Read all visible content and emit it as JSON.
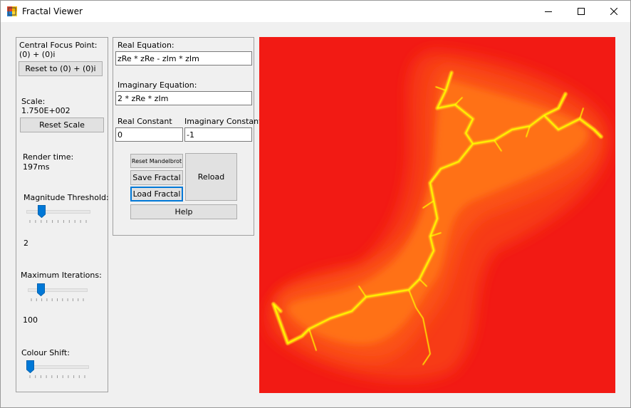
{
  "window": {
    "title": "Fractal Viewer"
  },
  "left_panel": {
    "focus_label": "Central Focus Point:",
    "focus_value": "(0) + (0)i",
    "reset_focus_label": "Reset to (0) + (0)i",
    "scale_label": "Scale:",
    "scale_value": "1.750E+002",
    "reset_scale_label": "Reset Scale",
    "render_label": "Render time:",
    "render_value": "197ms",
    "magnitude_label": "Magnitude Threshold:",
    "magnitude_value": "2",
    "iterations_label": "Maximum Iterations:",
    "iterations_value": "100",
    "colour_label": "Colour Shift:"
  },
  "sliders": {
    "magnitude_fraction": 0.2,
    "iterations_fraction": 0.18,
    "colour_fraction": 0.0
  },
  "equations": {
    "real_label": "Real Equation:",
    "real_value": "zRe * zRe - zIm * zIm",
    "imag_label": "Imaginary Equation:",
    "imag_value": "2 * zRe * zIm",
    "real_const_label": "Real Constant",
    "real_const_value": "0",
    "imag_const_label": "Imaginary Constant",
    "imag_const_value": "-1"
  },
  "buttons": {
    "reset_mandelbrot": "Reset Mandelbrot",
    "save_fractal": "Save Fractal",
    "load_fractal": "Load Fractal",
    "reload": "Reload",
    "help": "Help"
  },
  "colors": {
    "fractal_outer": "#f21a14",
    "fractal_mid": "#ff5a12",
    "fractal_core": "#ffff00",
    "accent": "#0078d7"
  },
  "icons": {
    "app": "app-icon",
    "minimize": "minimize-icon",
    "maximize": "maximize-icon",
    "close": "close-icon"
  }
}
